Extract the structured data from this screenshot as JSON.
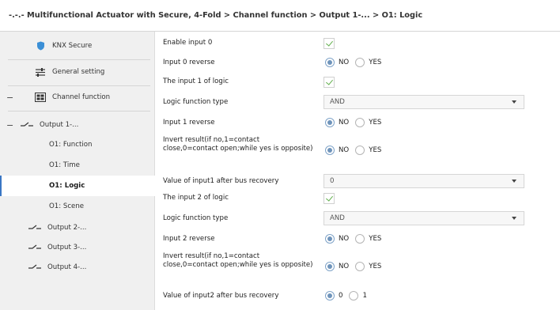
{
  "title": "-.-.- Multifunctional Actuator with Secure, 4-Fold > Channel function > Output 1-... > O1: Logic",
  "sidebar": {
    "items": [
      {
        "label": "KNX Secure"
      },
      {
        "label": "General setting"
      },
      {
        "label": "Channel function",
        "toggle": "−"
      },
      {
        "label": "Output 1-...",
        "toggle": "−"
      },
      {
        "label": "O1: Function"
      },
      {
        "label": "O1: Time"
      },
      {
        "label": "O1: Logic",
        "selected": true
      },
      {
        "label": "O1: Scene"
      },
      {
        "label": "Output 2-..."
      },
      {
        "label": "Output 3-..."
      },
      {
        "label": "Output 4-..."
      }
    ]
  },
  "params": [
    {
      "label": "Enable input 0",
      "type": "checkbox",
      "checked": true
    },
    {
      "label": "Input 0 reverse",
      "type": "radio",
      "options": [
        "NO",
        "YES"
      ],
      "selected": "NO"
    },
    {
      "label": "The input 1 of logic",
      "type": "checkbox",
      "checked": true
    },
    {
      "label": "Logic function type",
      "type": "select",
      "value": "AND"
    },
    {
      "label": "Input 1 reverse",
      "type": "radio",
      "options": [
        "NO",
        "YES"
      ],
      "selected": "NO"
    },
    {
      "label": "Invert result(if no,1=contact close,0=contact open;while yes is opposite)",
      "type": "radio",
      "options": [
        "NO",
        "YES"
      ],
      "selected": "NO"
    },
    {
      "label": "Value of input1 after bus recovery",
      "type": "select",
      "value": "0"
    },
    {
      "label": "The input 2 of logic",
      "type": "checkbox",
      "checked": true
    },
    {
      "label": "Logic function type",
      "type": "select",
      "value": "AND"
    },
    {
      "label": "Input 2 reverse",
      "type": "radio",
      "options": [
        "NO",
        "YES"
      ],
      "selected": "NO"
    },
    {
      "label": "Invert result(if no,1=contact close,0=contact open;while yes is opposite)",
      "type": "radio",
      "options": [
        "NO",
        "YES"
      ],
      "selected": "NO"
    },
    {
      "label": "Value of input2 after bus recovery",
      "type": "radio",
      "options": [
        "0",
        "1"
      ],
      "selected": "0"
    }
  ],
  "colors": {
    "accent": "#3a76c4",
    "check": "#5fae4a",
    "radio_dot": "#6f94bb",
    "shield": "#3b8fd6"
  }
}
